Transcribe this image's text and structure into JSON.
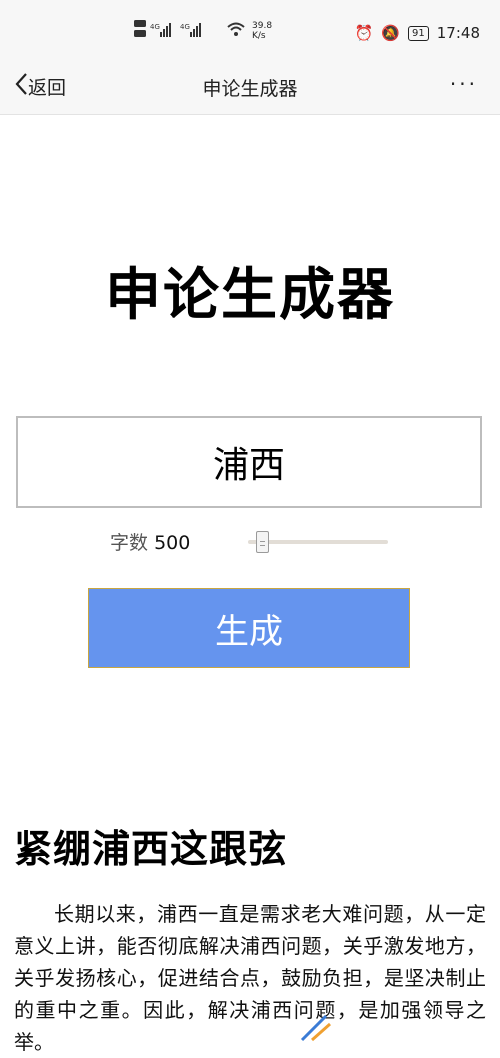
{
  "status": {
    "left_indicators": "HD 4G 4G",
    "speed": "39.8\nK/s",
    "battery": "91",
    "time": "17:48"
  },
  "nav": {
    "back": "返回",
    "title": "申论生成器",
    "more": "···"
  },
  "main": {
    "title": "申论生成器",
    "topic_value": "浦西",
    "word_count_label": "字数",
    "word_count_value": "500",
    "generate_label": "生成"
  },
  "essay": {
    "title": "紧绷浦西这跟弦",
    "body": "长期以来，浦西一直是需求老大难问题，从一定意义上讲，能否彻底解决浦西问题，关乎激发地方，关乎发扬核心，促进结合点，鼓励负担，是坚决制止的重中之重。因此，解决浦西问题，是加强领导之举。"
  },
  "slider": {
    "fraction": 0.1
  },
  "colors": {
    "button": "#6594ee",
    "button_border": "#c9a640",
    "bar_bg": "#f7f7f7"
  }
}
